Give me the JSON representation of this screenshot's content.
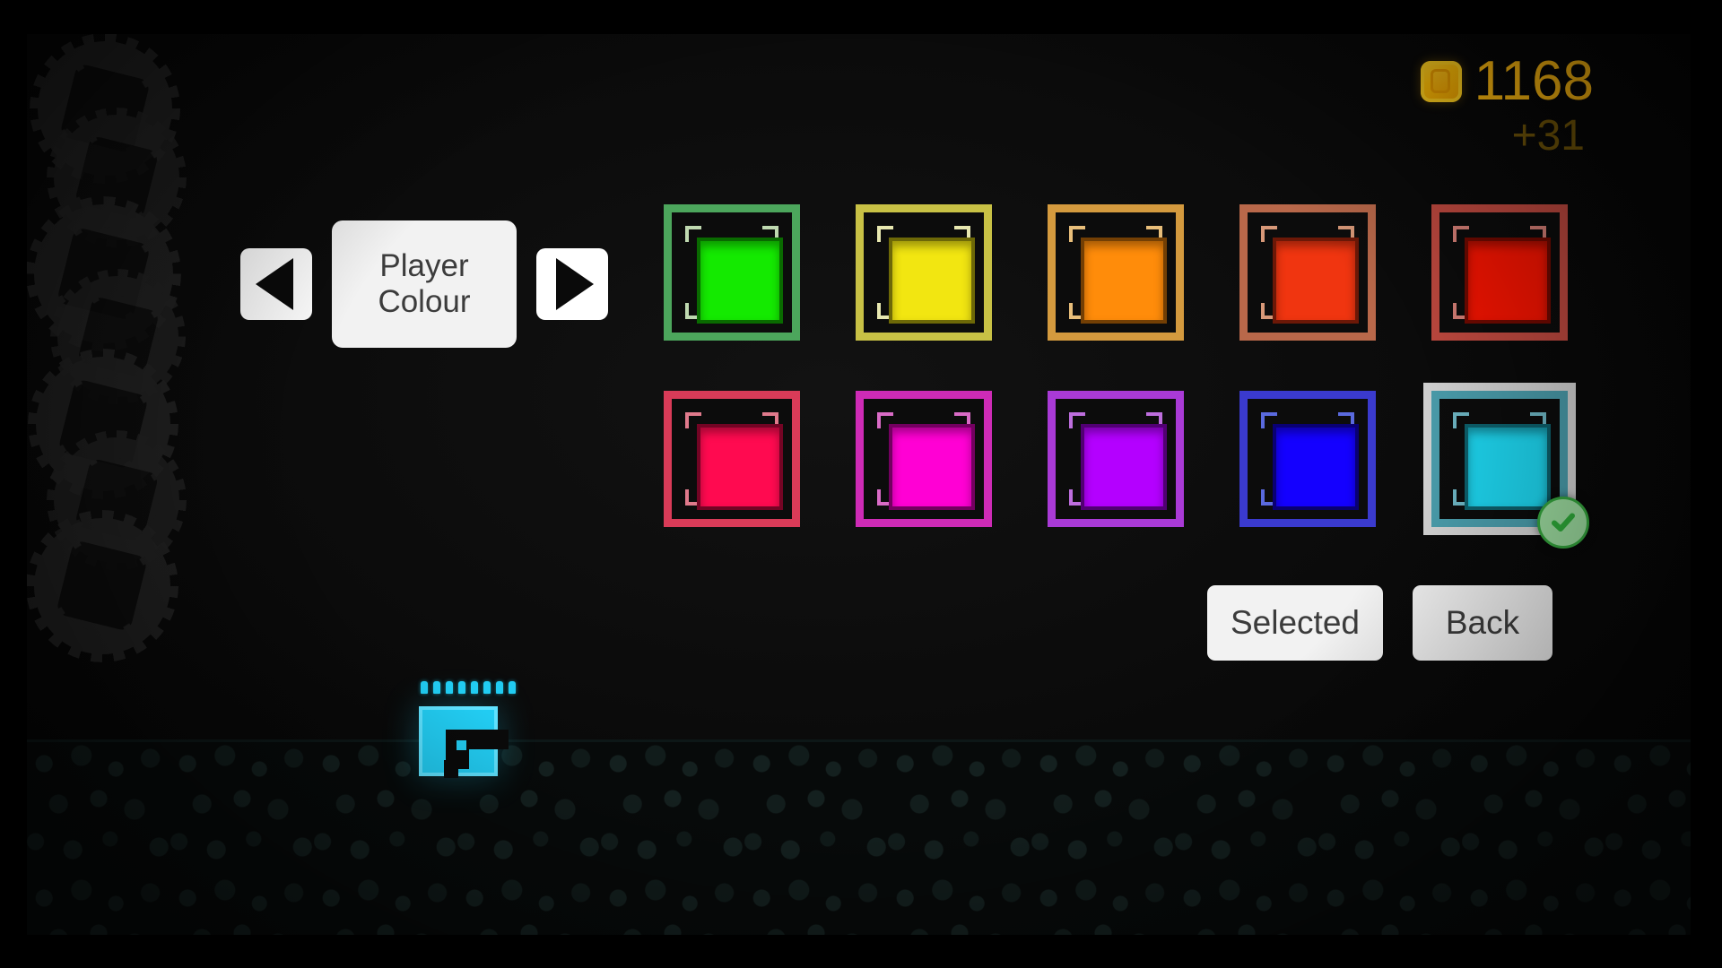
{
  "hud": {
    "coin_icon": "coin-icon",
    "coin_count": "1168",
    "coin_delta": "+31"
  },
  "selector": {
    "prev_icon": "triangle-left-icon",
    "next_icon": "triangle-right-icon",
    "label": "Player Colour"
  },
  "swatches": [
    {
      "name": "green",
      "fill": "#14EA00",
      "border": "#4CA65C",
      "bracket": "#BFD9B0",
      "selected": false
    },
    {
      "name": "yellow",
      "fill": "#F2E611",
      "border": "#C8C145",
      "bracket": "#E8E8B0",
      "selected": false
    },
    {
      "name": "orange",
      "fill": "#FF8C0A",
      "border": "#D49A3E",
      "bracket": "#E8BE7A",
      "selected": false
    },
    {
      "name": "red-orange",
      "fill": "#F03510",
      "border": "#B9684A",
      "bracket": "#D79878",
      "selected": false
    },
    {
      "name": "red",
      "fill": "#FA1400",
      "border": "#C24A40",
      "bracket": "#D98178",
      "selected": false
    },
    {
      "name": "pink",
      "fill": "#FF0A50",
      "border": "#D93B58",
      "bracket": "#E07A8C",
      "selected": false
    },
    {
      "name": "magenta",
      "fill": "#FF00D4",
      "border": "#CE2BB6",
      "bracket": "#D96BC6",
      "selected": false
    },
    {
      "name": "purple",
      "fill": "#B400FF",
      "border": "#A93AD6",
      "bracket": "#BE6EDE",
      "selected": false
    },
    {
      "name": "blue",
      "fill": "#1400FF",
      "border": "#3A3ACE",
      "bracket": "#5A6ADE",
      "selected": false
    },
    {
      "name": "cyan",
      "fill": "#1ED8F2",
      "border": "#4B9FAE",
      "bracket": "#6FB8C6",
      "selected": true
    }
  ],
  "selected_swatch_name": "cyan",
  "check_badge": {
    "icon": "check-circle-icon",
    "color": "#2FAE3B"
  },
  "actions": {
    "confirm_label": "Selected",
    "back_label": "Back"
  },
  "player": {
    "sprite_color": "#22CCF2",
    "ammo_pips": 8
  }
}
